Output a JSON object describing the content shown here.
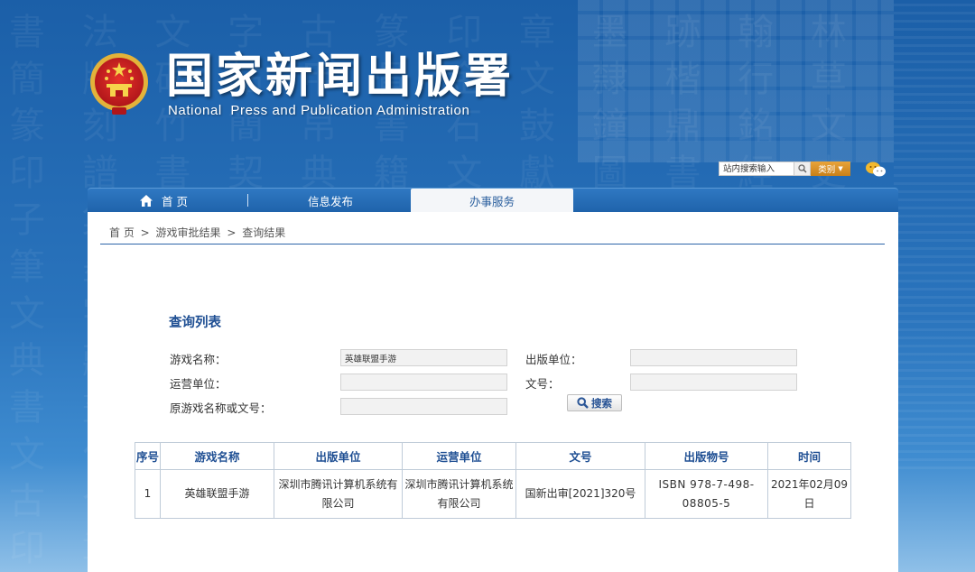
{
  "header": {
    "title": "国家新闻出版署",
    "subtitle": "National  Press and Publication Administration"
  },
  "site_search": {
    "placeholder": "站内搜索输入",
    "category": "类别"
  },
  "nav": {
    "items": [
      {
        "label": "首 页"
      },
      {
        "label": "信息发布"
      },
      {
        "label": "办事服务"
      }
    ],
    "active": "办事服务"
  },
  "breadcrumb": [
    "首 页",
    ">",
    "游戏审批结果",
    ">",
    "查询结果"
  ],
  "query": {
    "title": "查询列表",
    "game_name_label": "游戏名称：",
    "game_name_value": "英雄联盟手游",
    "publisher_label": "出版单位：",
    "publisher_value": "",
    "operator_label": "运营单位：",
    "operator_value": "",
    "doc_no_label": "文号：",
    "doc_no_value": "",
    "orig_label": "原游戏名称或文号：",
    "orig_value": "",
    "search_button": "搜索"
  },
  "results": {
    "headers": [
      "序号",
      "游戏名称",
      "出版单位",
      "运营单位",
      "文号",
      "出版物号",
      "时间"
    ],
    "rows": [
      {
        "no": "1",
        "name": "英雄联盟手游",
        "publisher": "深圳市腾讯计算机系统有限公司",
        "operator": "深圳市腾讯计算机系统有限公司",
        "doc_no": "国新出审[2021]320号",
        "isbn": "ISBN 978-7-498-08805-5",
        "date": "2021年02月09日"
      }
    ]
  },
  "colors": {
    "banner_blue": "#1b5fa8",
    "nav_blue": "#1f63ab",
    "title_blue": "#1f4f93",
    "search_orange": "#e8a33a"
  }
}
